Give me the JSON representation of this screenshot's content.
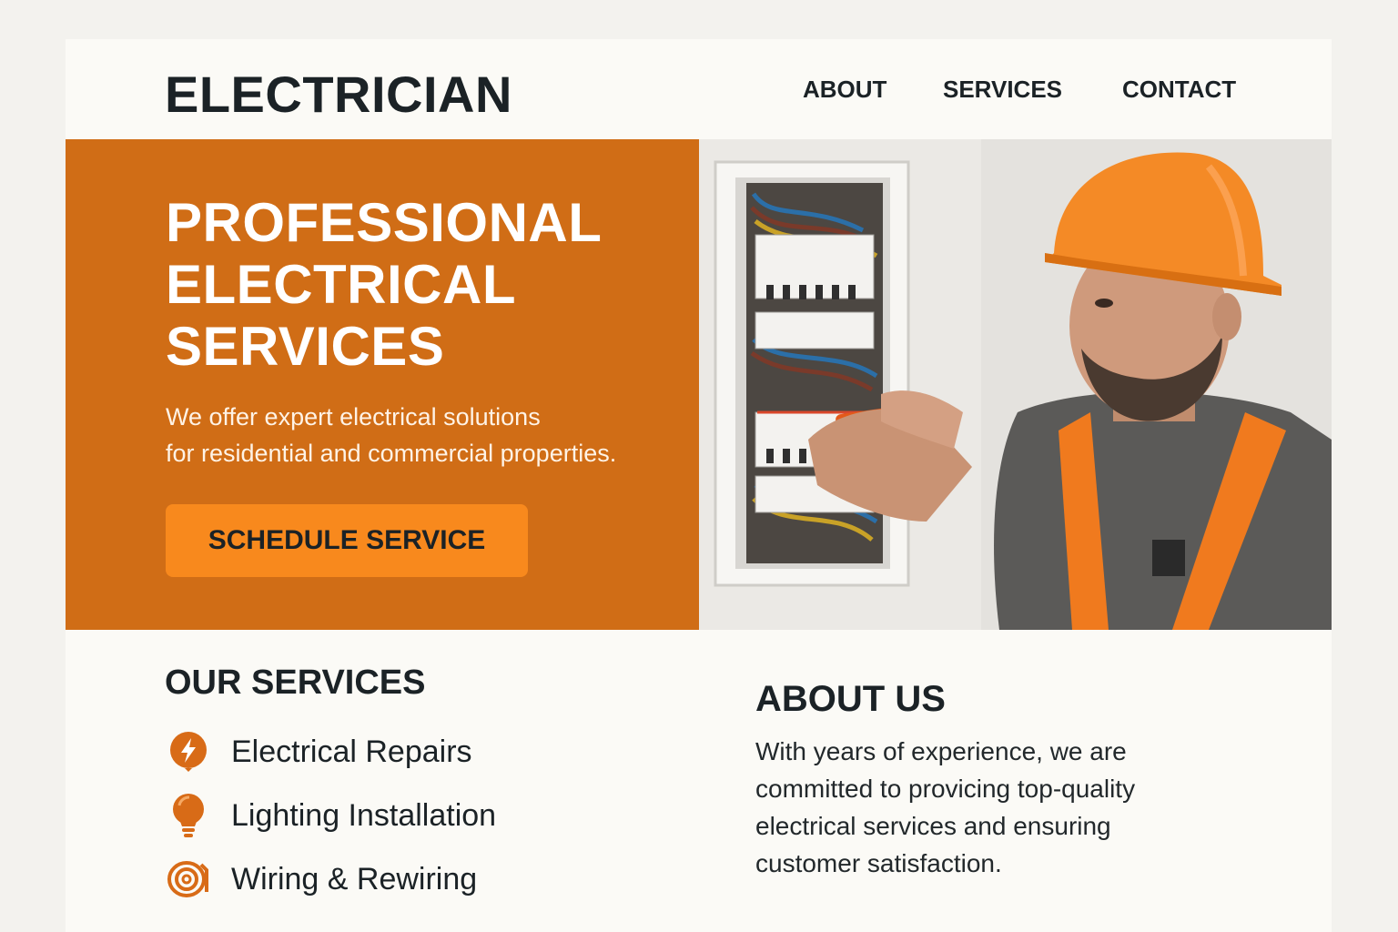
{
  "header": {
    "logo": "ELECTRICIAN",
    "nav": {
      "about": "ABOUT",
      "services": "SERVICES",
      "contact": "CONTACT"
    }
  },
  "hero": {
    "title_lines": [
      "PROFESSIONAL",
      "ELECTRICAL",
      "SERVICES"
    ],
    "description_lines": [
      "We offer expert electrical solutions",
      "for residential and commercial properties."
    ],
    "cta_label": "SCHEDULE SERVICE",
    "image": "electrician-photo"
  },
  "services": {
    "heading": "OUR SERVICES",
    "items": [
      {
        "label": "Electrical Repairs",
        "icon": "bolt-icon"
      },
      {
        "label": "Lighting Installation",
        "icon": "lightbulb-icon"
      },
      {
        "label": "Wiring & Rewiring",
        "icon": "wire-coil-icon"
      }
    ]
  },
  "about": {
    "heading": "ABOUT US",
    "text_lines": [
      "With years of experience, we are",
      "committed to provicing top-quality",
      "electrical services and ensuring",
      "customer satisfaction."
    ]
  },
  "colors": {
    "accent": "#d06d16",
    "button": "#f8891d",
    "text": "#1b2226",
    "background": "#fbfaf6"
  }
}
